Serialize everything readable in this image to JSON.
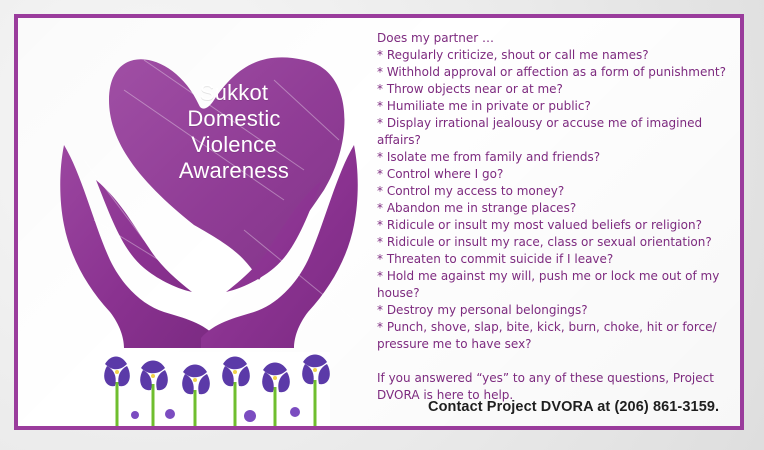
{
  "heart": {
    "line1": "Sukkot",
    "line2": "Domestic",
    "line3": "Violence",
    "line4": "Awareness"
  },
  "info": {
    "intro": "Does my partner …",
    "items": [
      "* Regularly criticize, shout or call me names?",
      "* Withhold approval or affection as a form of punishment?",
      "* Throw objects near or at me?",
      "* Humiliate me in private or public?",
      "* Display irrational jealousy or accuse me of imagined affairs?",
      "* Isolate me from family and friends?",
      "* Control where I go?",
      "* Control my access to money?",
      "* Abandon me in strange places?",
      "* Ridicule or insult my most valued beliefs or religion?",
      "* Ridicule or insult my race, class or sexual orientation?",
      "* Threaten to commit suicide if I leave?",
      "* Hold me against my will, push me or lock me out of my house?",
      "* Destroy my personal belongings?",
      "* Punch, shove, slap, bite, kick, burn, choke, hit or force/ pressure me to have sex?"
    ],
    "closing": "If you answered “yes” to any of these questions, Project DVORA is here to help."
  },
  "contact": {
    "text": "Contact Project DVORA at (206) 861-3159."
  },
  "colors": {
    "frame": "#9a3c9c",
    "purple": "#8e3a91",
    "text": "#7d2a7f",
    "contact": "#1f1f1f"
  },
  "icons": {
    "heart": "heart-icon",
    "hands": "hands-icon",
    "flowers": "iris-flowers-icon"
  }
}
